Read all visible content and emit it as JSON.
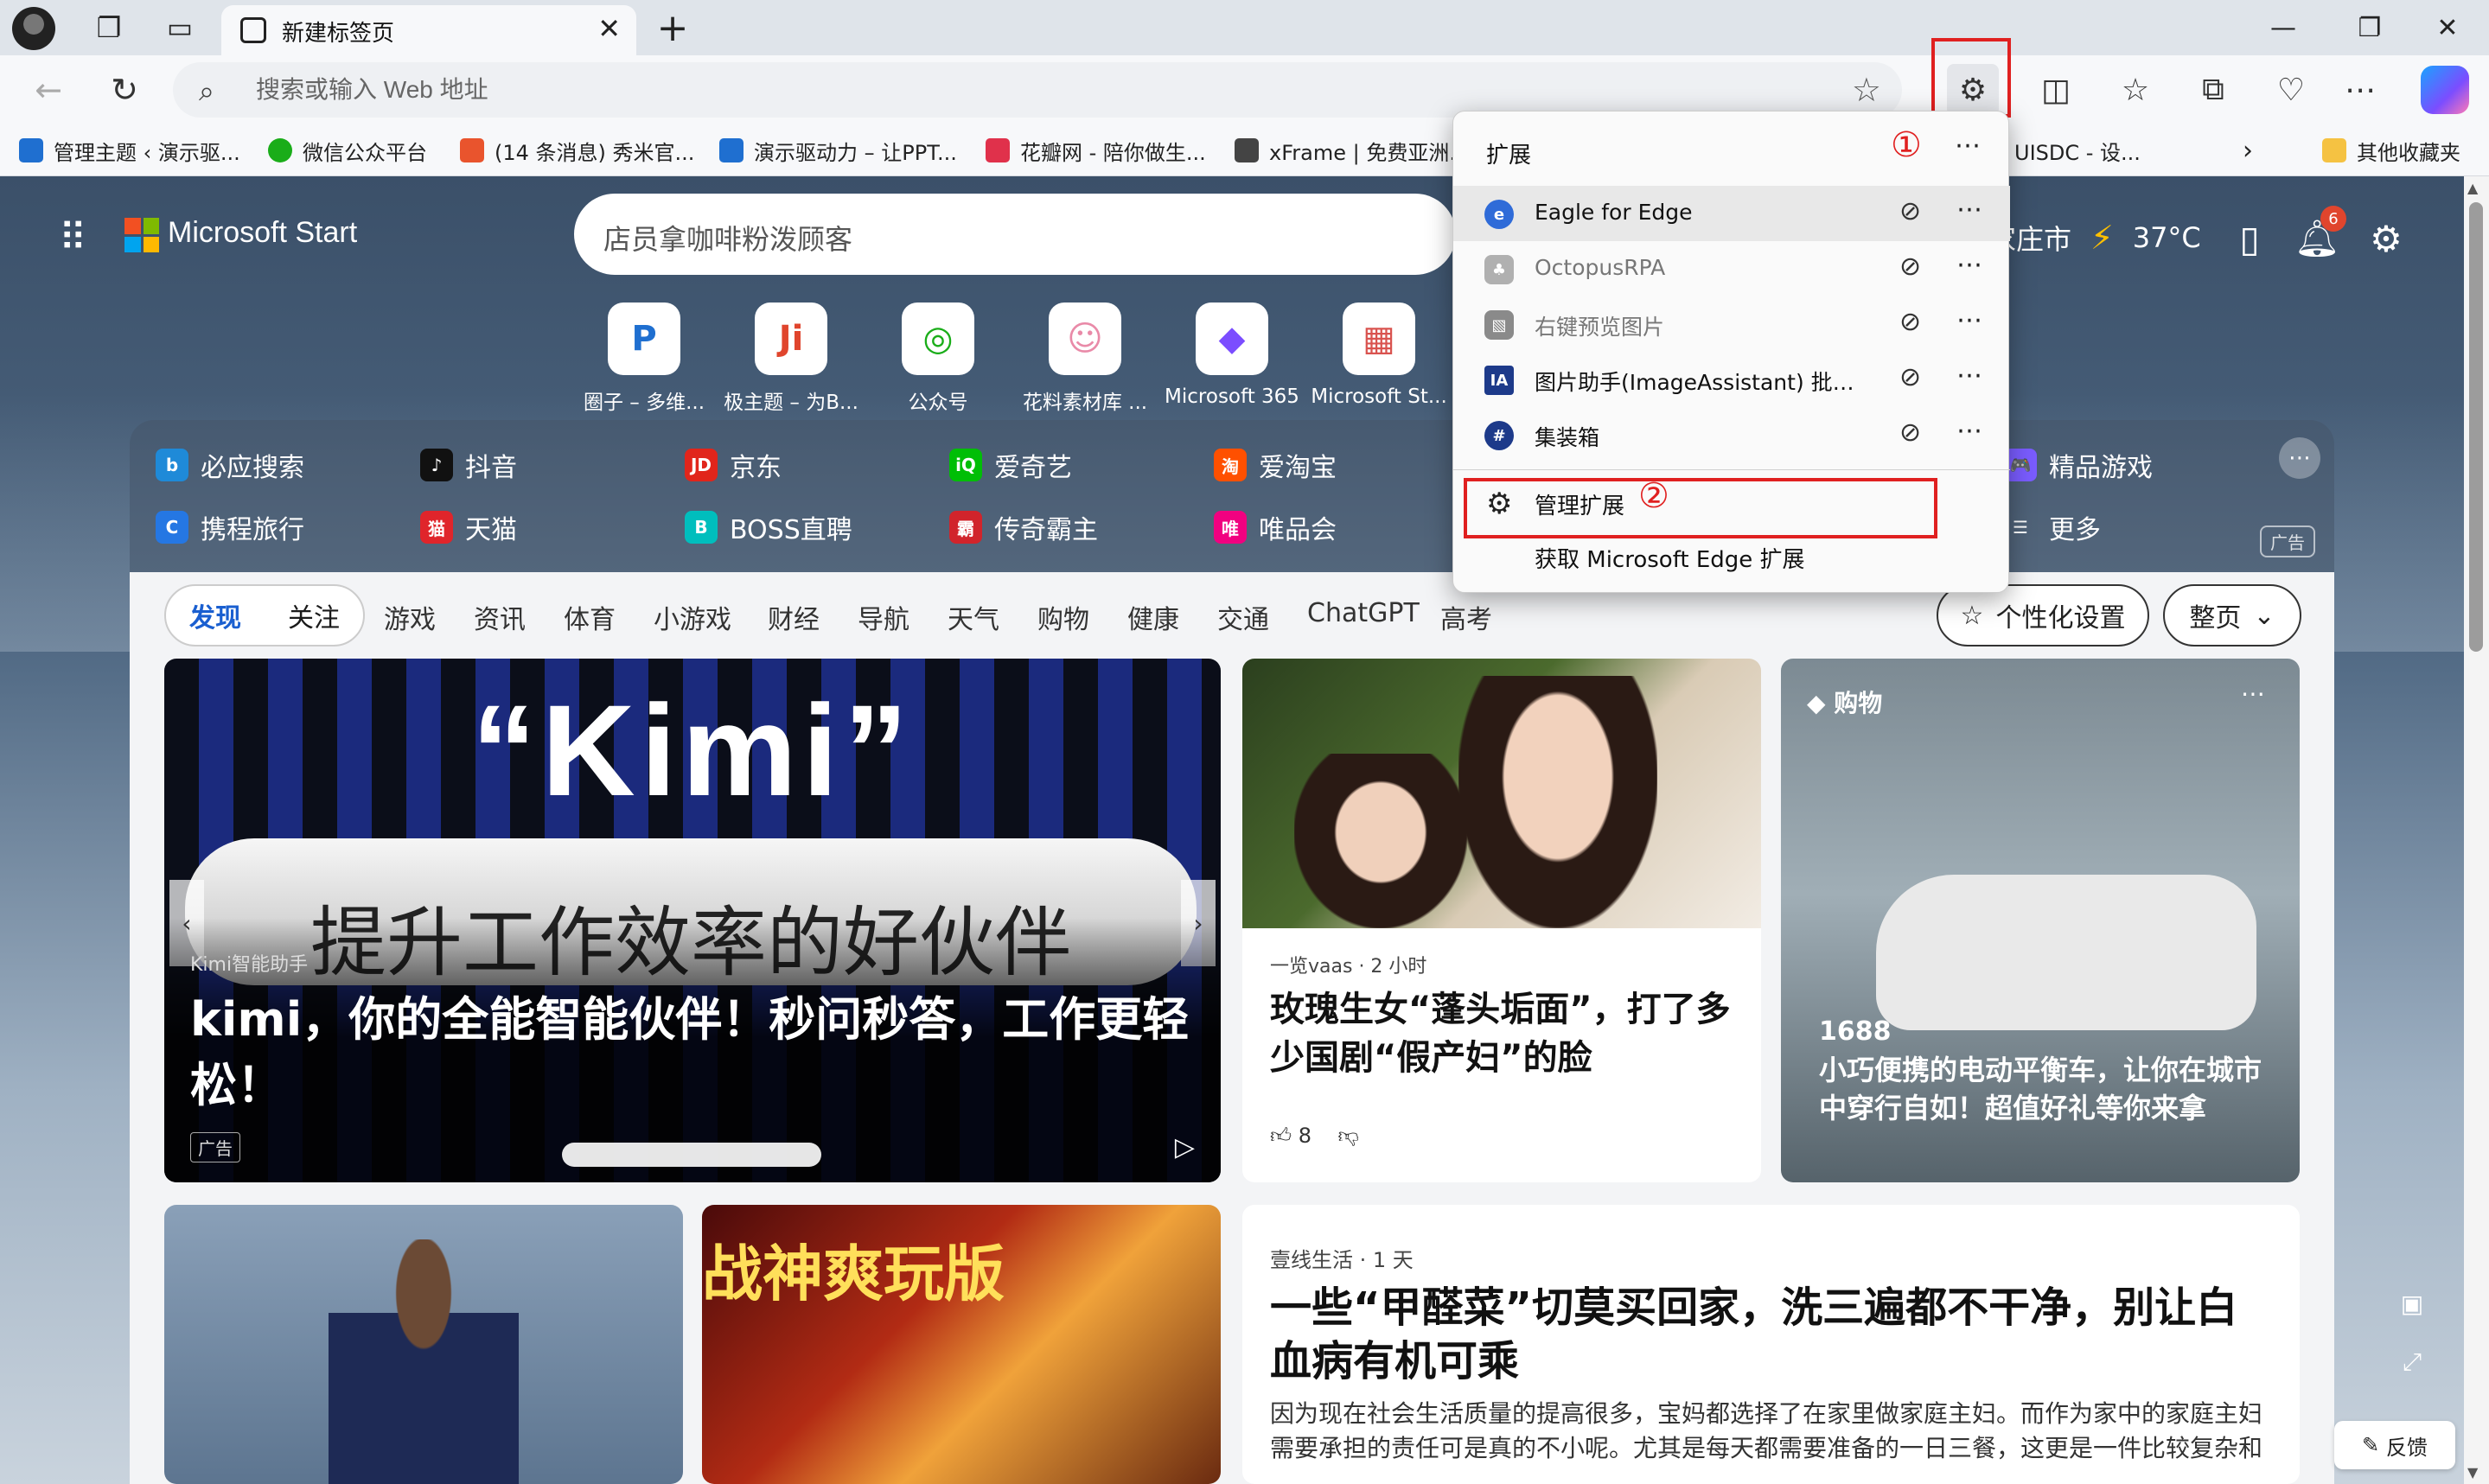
{
  "browser": {
    "tab_title": "新建标签页",
    "address_placeholder": "搜索或输入 Web 地址",
    "favorites": [
      {
        "label": "管理主题 ‹ 演示驱...",
        "color": "#1f6fd0"
      },
      {
        "label": "微信公众平台",
        "color": "#1aad19"
      },
      {
        "label": "(14 条消息) 秀米官...",
        "color": "#e9542d"
      },
      {
        "label": "演示驱动力 – 让PPT...",
        "color": "#1f6fd0"
      },
      {
        "label": "花瓣网 - 陪你做生...",
        "color": "#e0314b"
      },
      {
        "label": "xFrame | 免费亚洲...",
        "color": "#444444"
      },
      {
        "label": "UISDC - 设...",
        "color": "#2a2a2a"
      }
    ],
    "other_favorites": "其他收藏夹"
  },
  "extensions_menu": {
    "title": "扩展",
    "step1": "①",
    "step2": "②",
    "items": [
      {
        "name": "Eagle for Edge",
        "icon": "eagle-icon",
        "color": "#2f6bd8",
        "active": true
      },
      {
        "name": "OctopusRPA",
        "icon": "octopus-icon",
        "color": "#9a9a9a",
        "active": false
      },
      {
        "name": "右键预览图片",
        "icon": "image-icon",
        "color": "#8a8a8a",
        "active": false
      },
      {
        "name": "图片助手(ImageAssistant) 批量图...",
        "icon": "ia-icon",
        "color": "#1d3a8a",
        "active": false
      },
      {
        "name": "集装箱",
        "icon": "hash-icon",
        "color": "#1d3a8a",
        "active": false
      }
    ],
    "manage_label": "管理扩展",
    "get_label": "获取 Microsoft Edge 扩展"
  },
  "start_page": {
    "brand": "Microsoft Start",
    "search_text": "店员拿咖啡粉泼顾客",
    "weather_city": "家庄市",
    "weather_temp": "37°C",
    "notification_count": "6",
    "quick_links": [
      {
        "label": "圈子 – 多维...",
        "glyph": "P",
        "color": "#1f6fd0"
      },
      {
        "label": "极主题 – 为B...",
        "glyph": "Ji",
        "color": "#e0452d"
      },
      {
        "label": "公众号",
        "glyph": "◎",
        "color": "#1aad19"
      },
      {
        "label": "花料素材库 ...",
        "glyph": "☺",
        "color": "#e98aa8"
      },
      {
        "label": "Microsoft 365",
        "glyph": "◆",
        "color": "#7b4dff"
      },
      {
        "label": "Microsoft St...",
        "glyph": "▦",
        "color": "#d9534f"
      }
    ],
    "sites": [
      {
        "label": "必应搜索",
        "color": "#1f8ad8",
        "glyph": "b"
      },
      {
        "label": "抖音",
        "color": "#111111",
        "glyph": "♪"
      },
      {
        "label": "京东",
        "color": "#e1251b",
        "glyph": "JD"
      },
      {
        "label": "爱奇艺",
        "color": "#00be06",
        "glyph": "iQ"
      },
      {
        "label": "爱淘宝",
        "color": "#ff5000",
        "glyph": "淘"
      },
      {
        "label": "携程旅行",
        "color": "#2577e3",
        "glyph": "C"
      },
      {
        "label": "天猫",
        "color": "#e0252b",
        "glyph": "猫"
      },
      {
        "label": "BOSS直聘",
        "color": "#00bebd",
        "glyph": "B"
      },
      {
        "label": "传奇霸主",
        "color": "#d1242b",
        "glyph": "霸"
      },
      {
        "label": "唯品会",
        "color": "#f10180",
        "glyph": "唯"
      },
      {
        "label": "精品游戏",
        "color": "#7a5cff",
        "glyph": "🎮"
      },
      {
        "label": "更多",
        "color": "transparent",
        "glyph": "☰"
      }
    ],
    "ad_label": "广告",
    "feed_tabs_primary": [
      "发现",
      "关注"
    ],
    "feed_tabs": [
      "游戏",
      "资讯",
      "体育",
      "小游戏",
      "财经",
      "导航",
      "天气",
      "购物",
      "健康",
      "交通",
      "ChatGPT",
      "高考"
    ],
    "personalize_label": "个性化设置",
    "layout_label": "整页",
    "feedback_label": "反馈"
  },
  "cards": {
    "kimi": {
      "big_word": "“Kimi”",
      "slogan": "提升工作效率的好伙伴",
      "source": "Kimi智能助手",
      "title": "kimi，你的全能智能伙伴！秒问秒答，工作更轻松！",
      "ad": "广告"
    },
    "liu": {
      "source": "一览vaas · 2 小时",
      "title": "玫瑰生女“蓬头垢面”，打了多少国剧“假产妇”的脸",
      "likes": "8"
    },
    "shop": {
      "tag": "购物",
      "price": "1688",
      "title": "小巧便携的电动平衡车，让你在城市中穿行自如！超值好礼等你来拿"
    },
    "game": {
      "title": "战神爽玩版"
    },
    "news": {
      "source": "壹线生活 · 1 天",
      "title": "一些“甲醛菜”切莫买回家，洗三遍都不干净，别让白血病有机可乘",
      "summary": "因为现在社会生活质量的提高很多，宝妈都选择了在家里做家庭主妇。而作为家中的家庭主妇需要承担的责任可是真的不小呢。尤其是每天都需要准备的一日三餐，这更是一件比较复杂和"
    }
  }
}
